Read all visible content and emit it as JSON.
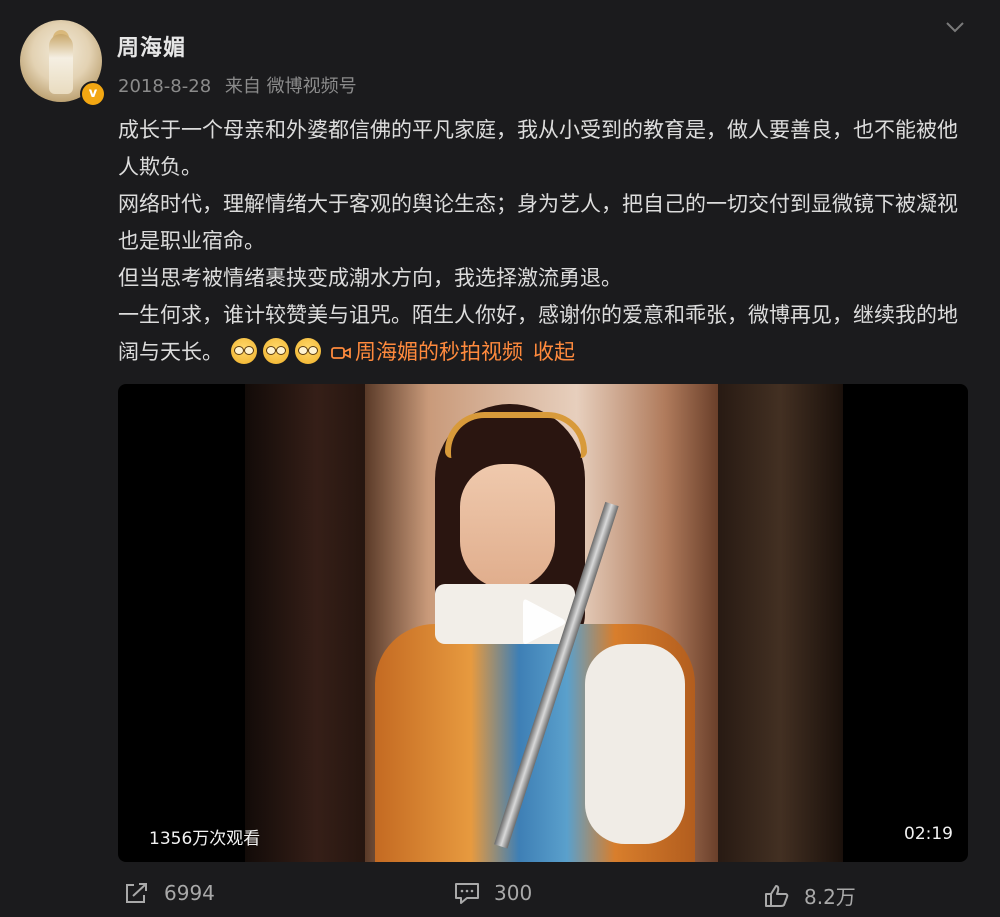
{
  "post": {
    "username": "周海媚",
    "date": "2018-8-28",
    "source": "来自 微博视频号",
    "paragraphs": [
      "成长于一个母亲和外婆都信佛的平凡家庭，我从小受到的教育是，做人要善良，也不能被他人欺负。",
      "网络时代，理解情绪大于客观的舆论生态；身为艺人，把自己的一切交付到显微镜下被凝视也是职业宿命。",
      "但当思考被情绪裹挟变成潮水方向，我选择激流勇退。",
      "一生何求，谁计较赞美与诅咒。陌生人你好，感谢你的爱意和乖张，微博再见，继续我的地阔与天长。"
    ],
    "video_link_text": "周海媚的秒拍视频",
    "collapse_label": "收起",
    "emojis": [
      "nerd-face-emoji",
      "nerd-face-emoji",
      "nerd-face-emoji"
    ]
  },
  "video": {
    "views": "1356万次观看",
    "duration": "02:19"
  },
  "actions": {
    "share_count": "6994",
    "comment_count": "300",
    "like_count": "8.2万"
  },
  "colors": {
    "background": "#1b1b1d",
    "accent": "#ff8a3d",
    "verify_badge": "#f3a712",
    "muted_text": "#8b8b8b"
  },
  "icons": {
    "more": "chevron-down-icon",
    "share": "share-icon",
    "comment": "comment-icon",
    "like": "thumbs-up-icon",
    "video_link": "video-camera-icon",
    "play": "play-icon",
    "verified": "verified-badge-icon"
  }
}
